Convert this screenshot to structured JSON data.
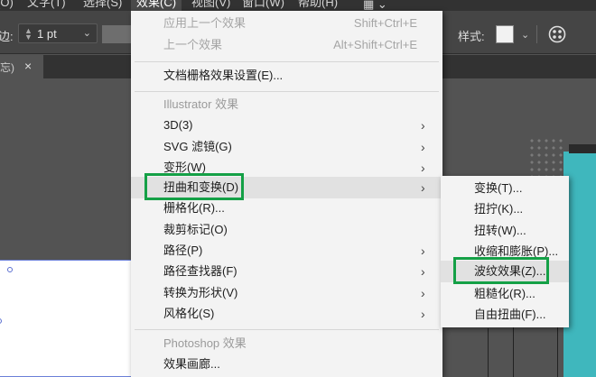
{
  "menubar": {
    "items": [
      {
        "label": "(O)"
      },
      {
        "label": "文字(T)"
      },
      {
        "label": "选择(S)"
      },
      {
        "label": "效果(C)"
      },
      {
        "label": "视图(V)"
      },
      {
        "label": "窗口(W)"
      },
      {
        "label": "帮助(H)"
      }
    ]
  },
  "control_bar": {
    "stroke_label": "边:",
    "stroke_value": "1 pt",
    "style_label": "样式:"
  },
  "tabbar": {
    "tab_name": "忘)",
    "close_glyph": "×"
  },
  "effect_menu": {
    "items": [
      {
        "label": "应用上一个效果",
        "shortcut": "Shift+Ctrl+E"
      },
      {
        "label": "上一个效果",
        "shortcut": "Alt+Shift+Ctrl+E"
      },
      {
        "label": "文档栅格效果设置(E)..."
      },
      {
        "label": "Illustrator 效果"
      },
      {
        "label": "3D(3)"
      },
      {
        "label": "SVG 滤镜(G)"
      },
      {
        "label": "变形(W)"
      },
      {
        "label": "扭曲和变换(D)"
      },
      {
        "label": "栅格化(R)..."
      },
      {
        "label": "裁剪标记(O)"
      },
      {
        "label": "路径(P)"
      },
      {
        "label": "路径查找器(F)"
      },
      {
        "label": "转换为形状(V)"
      },
      {
        "label": "风格化(S)"
      },
      {
        "label": "Photoshop 效果"
      },
      {
        "label": "效果画廊..."
      }
    ],
    "arrow_glyph": "›"
  },
  "distort_submenu": {
    "items": [
      {
        "label": "变换(T)..."
      },
      {
        "label": "扭拧(K)..."
      },
      {
        "label": "扭转(W)..."
      },
      {
        "label": "收缩和膨胀(P)..."
      },
      {
        "label": "波纹效果(Z)..."
      },
      {
        "label": "粗糙化(R)..."
      },
      {
        "label": "自由扭曲(F)..."
      }
    ]
  },
  "colors": {
    "highlight_box": "#14a046",
    "menu_bg": "#f3f3f3",
    "canvas_bg": "#535353",
    "teal_accent": "#3fb7bd"
  }
}
